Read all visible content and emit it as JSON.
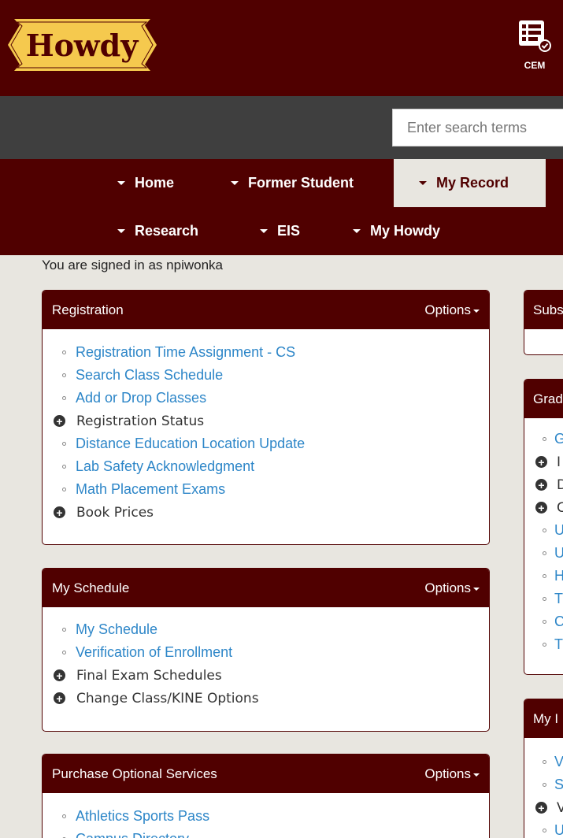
{
  "header": {
    "logo_text": "Howdy",
    "cem_label": "CEM"
  },
  "search": {
    "placeholder": "Enter search terms"
  },
  "nav": {
    "items": [
      {
        "label": "Home"
      },
      {
        "label": "Former Student"
      },
      {
        "label": "My Record"
      },
      {
        "label": "Research"
      },
      {
        "label": "EIS"
      },
      {
        "label": "My Howdy"
      }
    ],
    "active": "My Record"
  },
  "signed_in_text": "You are signed in as npiwonka",
  "panels": {
    "registration": {
      "title": "Registration",
      "options_label": "Options",
      "items": [
        {
          "type": "link",
          "label": "Registration Time Assignment - CS"
        },
        {
          "type": "link",
          "label": "Search Class Schedule"
        },
        {
          "type": "link",
          "label": "Add or Drop Classes"
        },
        {
          "type": "expand",
          "label": "Registration Status"
        },
        {
          "type": "link",
          "label": "Distance Education Location Update"
        },
        {
          "type": "link",
          "label": "Lab Safety Acknowledgment"
        },
        {
          "type": "link",
          "label": "Math Placement Exams"
        },
        {
          "type": "expand",
          "label": "Book Prices"
        }
      ]
    },
    "my_schedule": {
      "title": "My Schedule",
      "options_label": "Options",
      "items": [
        {
          "type": "link",
          "label": "My Schedule"
        },
        {
          "type": "link",
          "label": "Verification of Enrollment"
        },
        {
          "type": "expand",
          "label": "Final Exam Schedules"
        },
        {
          "type": "expand",
          "label": "Change Class/KINE Options"
        }
      ]
    },
    "purchase": {
      "title": "Purchase Optional Services",
      "options_label": "Options",
      "items": [
        {
          "type": "link",
          "label": "Athletics Sports Pass"
        },
        {
          "type": "link",
          "label": "Campus Directory"
        }
      ]
    }
  },
  "right_panels": {
    "sub": {
      "title": "Subs"
    },
    "grad": {
      "title": "Grad",
      "items": [
        {
          "type": "link",
          "label": "G"
        },
        {
          "type": "expand",
          "label": "I"
        },
        {
          "type": "expand",
          "label": "D"
        },
        {
          "type": "expand",
          "label": "C"
        },
        {
          "type": "link",
          "label": "U"
        },
        {
          "type": "link",
          "label": "U"
        },
        {
          "type": "link",
          "label": "H"
        },
        {
          "type": "link",
          "label": "T"
        },
        {
          "type": "link",
          "label": "C"
        },
        {
          "type": "link",
          "label": "T"
        }
      ]
    },
    "myi": {
      "title": "My I",
      "items": [
        {
          "type": "link",
          "label": "V"
        },
        {
          "type": "link",
          "label": "S"
        },
        {
          "type": "expand",
          "label": "V"
        },
        {
          "type": "link",
          "label": "U"
        }
      ]
    }
  },
  "colors": {
    "maroon": "#500000",
    "search_bar": "#3f3f3f",
    "page_bg": "#e8e6e0",
    "link": "#2d86c8",
    "logo_gold": "#f5c94e"
  }
}
